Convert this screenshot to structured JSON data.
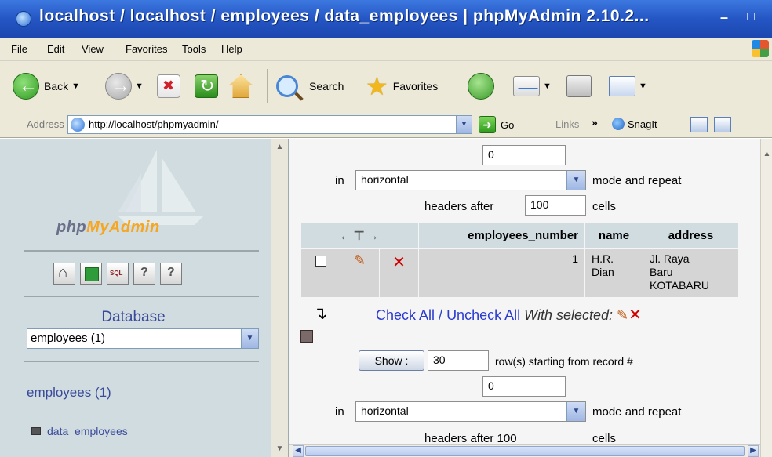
{
  "window": {
    "title": "localhost / localhost / employees / data_employees | phpMyAdmin 2.10.2...",
    "minimize": "–",
    "maximize": "□"
  },
  "menu": [
    "File",
    "Edit",
    "View",
    "Favorites",
    "Tools",
    "Help"
  ],
  "toolbar": {
    "back_label": "Back",
    "search_label": "Search",
    "favorites_label": "Favorites"
  },
  "address": {
    "label": "Address",
    "url": "http://localhost/phpmyadmin/",
    "go_label": "Go",
    "links_label": "Links",
    "chevron": "»",
    "snagit_label": "SnagIt"
  },
  "left": {
    "logo_php": "php",
    "logo_my": "My",
    "logo_admin": "Admin",
    "database_label": "Database",
    "database_selected": "employees (1)",
    "db_heading": "employees (1)",
    "tables": [
      "data_employees"
    ]
  },
  "main": {
    "top_input_value": "0",
    "in_label": "in",
    "mode_value": "horizontal",
    "mode_and_repeat": "mode and repeat",
    "headers_after": "headers after",
    "headers_after_value": "100",
    "cells": "cells",
    "columns": [
      "employees_number",
      "name",
      "address"
    ],
    "rows": [
      {
        "employees_number": "1",
        "name": "H.R.\nDian",
        "address": "Jl. Raya\nBaru\nKOTABARU"
      }
    ],
    "check_all": "Check All",
    "slash": " / ",
    "uncheck_all": "Uncheck All",
    "with_selected": "With selected:",
    "show_button": "Show :",
    "show_rows_value": "30",
    "rows_starting_from": "row(s) starting from record #",
    "second_input_value": "0",
    "second_mode_value": "horizontal",
    "headers_after_partial": "headers after 100",
    "cells_partial": "cells"
  }
}
